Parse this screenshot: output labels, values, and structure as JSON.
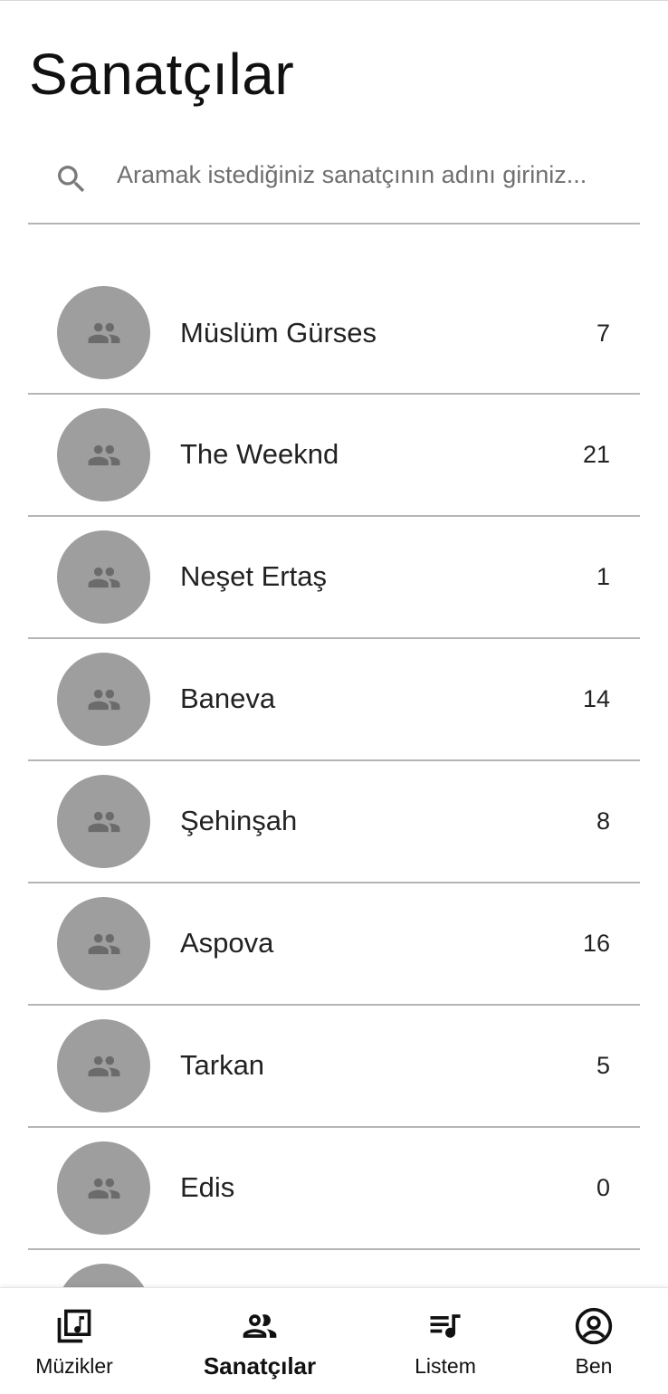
{
  "header": {
    "title": "Sanatçılar"
  },
  "search": {
    "placeholder": "Aramak istediğiniz sanatçının adını giriniz...",
    "value": "",
    "icon": "search-icon"
  },
  "artists": [
    {
      "name": "Müslüm Gürses",
      "count": "7"
    },
    {
      "name": "The Weeknd",
      "count": "21"
    },
    {
      "name": "Neşet Ertaş",
      "count": "1"
    },
    {
      "name": "Baneva",
      "count": "14"
    },
    {
      "name": "Şehinşah",
      "count": "8"
    },
    {
      "name": "Aspova",
      "count": "16"
    },
    {
      "name": "Tarkan",
      "count": "5"
    },
    {
      "name": "Edis",
      "count": "0"
    }
  ],
  "avatar_icon": "people-icon",
  "colors": {
    "avatar_bg": "#9e9e9e",
    "avatar_icon": "#6b6b6b",
    "divider": "#b5b5b5",
    "text": "#222222"
  },
  "bottom_nav": {
    "items": [
      {
        "label": "Müzikler",
        "icon": "music-library-icon",
        "active": false
      },
      {
        "label": "Sanatçılar",
        "icon": "people-icon",
        "active": true
      },
      {
        "label": "Listem",
        "icon": "playlist-icon",
        "active": false
      },
      {
        "label": "Ben",
        "icon": "account-circle-icon",
        "active": false
      }
    ]
  }
}
